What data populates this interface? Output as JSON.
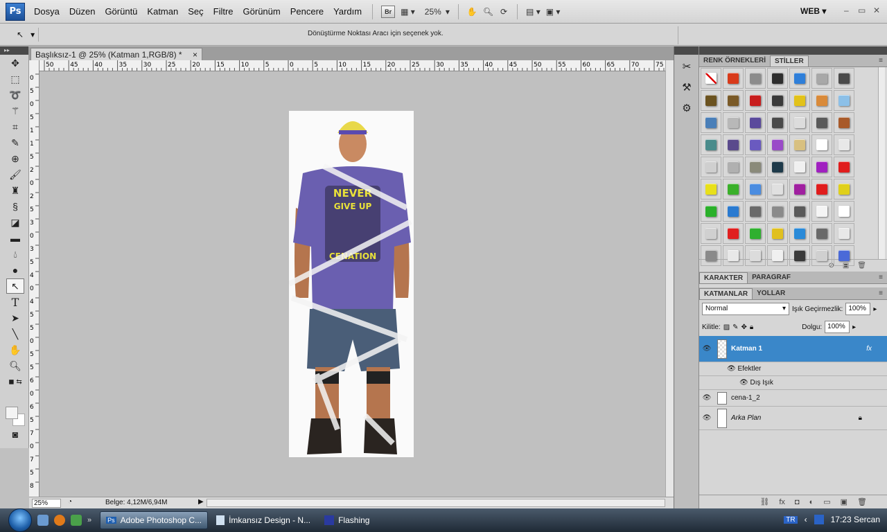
{
  "app": {
    "logo": "Ps"
  },
  "menu": [
    "Dosya",
    "Düzen",
    "Görüntü",
    "Katman",
    "Seç",
    "Filtre",
    "Görünüm",
    "Pencere",
    "Yardım"
  ],
  "appbar": {
    "bridge": "Br",
    "zoom": "25%",
    "workspace": "WEB"
  },
  "options": {
    "message": "Dönüştürme Noktası Aracı için seçenek yok."
  },
  "document": {
    "tab_title": "Başlıksız-1 @ 25% (Katman 1,RGB/8) *",
    "close": "×",
    "ruler_top": [
      "50",
      "45",
      "40",
      "35",
      "30",
      "25",
      "20",
      "15",
      "10",
      "5",
      "0",
      "5",
      "10",
      "15",
      "20",
      "25",
      "30",
      "35",
      "40",
      "45",
      "50",
      "55",
      "60",
      "65",
      "70",
      "75"
    ],
    "ruler_left": [
      "0",
      "5",
      "0",
      "5",
      "1",
      "1",
      "5",
      "2",
      "0",
      "2",
      "5",
      "3",
      "0",
      "3",
      "5",
      "4",
      "0",
      "4",
      "5",
      "5",
      "0",
      "5",
      "5",
      "6",
      "0",
      "6",
      "5",
      "7",
      "0",
      "7",
      "5",
      "8"
    ],
    "status_zoom": "25%",
    "status_doc": "Belge: 4,12M/6,94M"
  },
  "artwork": {
    "shirt_text_1": "NEVER",
    "shirt_text_2": "GIVE UP",
    "shirt_text_3": "CENATION",
    "shirt_color": "#6a5fb0",
    "shorts_color": "#4a5e78"
  },
  "styles_panel": {
    "tabs": [
      "RENK ÖRNEKLERİ",
      "STİLLER"
    ],
    "active_tab": "STİLLER",
    "swatches": [
      [
        "#ffffff",
        "#d83a1a",
        "#8c8c8c",
        "#2e2e2e",
        "#2f7fd9",
        "#a8a8a8",
        "#4a4a4a"
      ],
      [
        "#6b5320",
        "#7a5a28",
        "#c81e1e",
        "#3a3a3a",
        "#e2c21a",
        "#d98a3a",
        "#8cc0e8"
      ],
      [
        "#4a7fb8",
        "#b8b8b8",
        "#5a4a9c",
        "#4a4a4a",
        "#dcdcdc",
        "#5a5a5a",
        "#a85a2a"
      ],
      [
        "#4a8c8c",
        "#5a4a8c",
        "#6a5ac0",
        "#9a4ac8",
        "#d8c080",
        "#ffffff",
        "#e8e8e8"
      ],
      [
        "#cfcfcf",
        "#b0b0b0",
        "#8a8a7a",
        "#1e3a4a",
        "#f0f0f0",
        "#a020c0",
        "#e01c1c"
      ],
      [
        "#e8e01a",
        "#3ab02a",
        "#4a8ce0",
        "#e0e0e0",
        "#a020a0",
        "#e01c1c",
        "#e0d01a"
      ],
      [
        "#2ab02a",
        "#2a7ad0",
        "#6a6a6a",
        "#8a8a8a",
        "#5a5a5a",
        "#f4f4f4",
        "#ffffff"
      ],
      [
        "#d0d0d0",
        "#e02020",
        "#30b030",
        "#e0c020",
        "#2a8ad8",
        "#6a6a6a",
        "#e8e8e8"
      ],
      [
        "#8a8a8a",
        "#e8e8e8",
        "#dcdcdc",
        "#f0f0f0",
        "#3a3a3a",
        "#d0d0d0",
        "#4a6ad8"
      ]
    ]
  },
  "char_panel": {
    "tabs": [
      "KARAKTER",
      "PARAGRAF"
    ]
  },
  "layers_panel": {
    "tabs": [
      "KATMANLAR",
      "YOLLAR"
    ],
    "blend_mode": "Normal",
    "opacity_label": "Işık Geçirmezlik:",
    "opacity": "100%",
    "lock_label": "Kilitle:",
    "fill_label": "Dolgu:",
    "fill": "100%",
    "layers": [
      {
        "name": "Katman 1",
        "fx": "fx"
      },
      {
        "name": "Efektler"
      },
      {
        "name": "Dış Işık"
      },
      {
        "name": "cena-1_2"
      },
      {
        "name": "Arka Plan"
      }
    ]
  },
  "taskbar": {
    "tasks": [
      "Adobe Photoshop C...",
      "İmkansız Design - N...",
      "Flashing"
    ],
    "lang": "TR",
    "clock": "17:23 Sercan"
  }
}
